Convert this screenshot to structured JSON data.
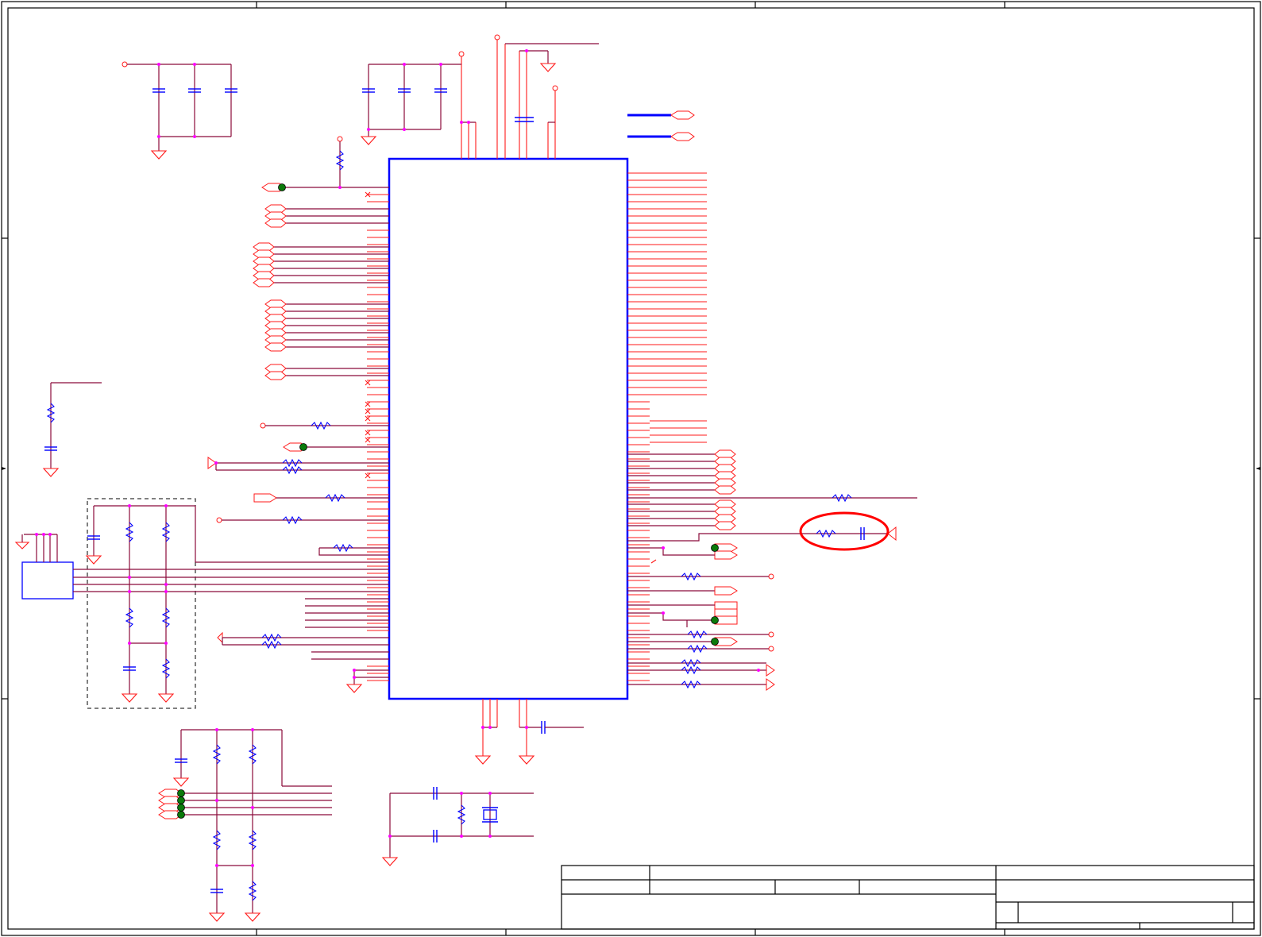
{
  "colors": {
    "wire": "#8b0a3a",
    "pin": "#ff1a1a",
    "component": "#0000ff",
    "junction": "#ff00ff",
    "test_point": "#0b7a0b",
    "highlight": "#ff0000",
    "frame": "#000000"
  },
  "components": {
    "main_ic": "main-ic",
    "crystal": "crystal-icon",
    "connector": "connector-icon",
    "highlighted_group": "rc-filter-highlight"
  }
}
